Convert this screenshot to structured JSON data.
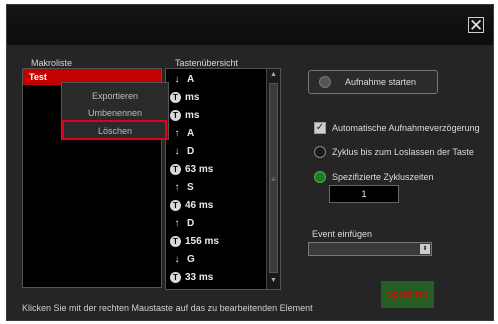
{
  "window": {
    "close_glyph": "✕"
  },
  "macrolist": {
    "label": "Makroliste",
    "selected_item": "Test"
  },
  "context_menu": {
    "items": [
      "Exportieren",
      "Umbenennen",
      "Löschen"
    ]
  },
  "keys": {
    "label": "Tastenübersicht",
    "rows": [
      {
        "type": "down",
        "icon_name": "arrow-down-icon",
        "glyph": "↓",
        "text": "A"
      },
      {
        "type": "time",
        "icon_name": "timer-icon",
        "glyph": "T",
        "text": "ms"
      },
      {
        "type": "time",
        "icon_name": "timer-icon",
        "glyph": "T",
        "text": "ms"
      },
      {
        "type": "up",
        "icon_name": "arrow-up-icon",
        "glyph": "↑",
        "text": "A"
      },
      {
        "type": "down",
        "icon_name": "arrow-down-icon",
        "glyph": "↓",
        "text": "D"
      },
      {
        "type": "time",
        "icon_name": "timer-icon",
        "glyph": "T",
        "text": "63 ms"
      },
      {
        "type": "up",
        "icon_name": "arrow-up-icon",
        "glyph": "↑",
        "text": "S"
      },
      {
        "type": "time",
        "icon_name": "timer-icon",
        "glyph": "T",
        "text": "46 ms"
      },
      {
        "type": "up",
        "icon_name": "arrow-up-icon",
        "glyph": "↑",
        "text": "D"
      },
      {
        "type": "time",
        "icon_name": "timer-icon",
        "glyph": "T",
        "text": "156 ms"
      },
      {
        "type": "down",
        "icon_name": "arrow-down-icon",
        "glyph": "↓",
        "text": "G"
      },
      {
        "type": "time",
        "icon_name": "timer-icon",
        "glyph": "T",
        "text": "33 ms"
      }
    ],
    "scroll_up_glyph": "▲",
    "scroll_down_glyph": "▼",
    "scroll_grip_glyph": "≡"
  },
  "record_button": {
    "label": "Aufnahme starten"
  },
  "options": {
    "auto_delay": {
      "label": "Automatische Aufnahmeverzögerung",
      "checked": true,
      "check_glyph": "✓"
    },
    "cycle_until_release": {
      "label": "Zyklus bis zum Loslassen der Taste",
      "selected": false
    },
    "specified_cycles": {
      "label": "Spezifizierte Zykluszeiten",
      "selected": true,
      "value": "1"
    }
  },
  "event": {
    "label": "Event einfügen",
    "value": "",
    "arrow_glyph": "⬍"
  },
  "save_button": {
    "label": "Speichern"
  },
  "hint": "Klicken Sie mit der rechten Maustaste auf das zu bearbeitenden Element",
  "colors": {
    "background": "#252525",
    "selection": "#c40000",
    "highlight_border": "#e0001a",
    "save_bg": "#245e24",
    "save_text": "#e00000",
    "radio_on": "#1f7a2e"
  }
}
